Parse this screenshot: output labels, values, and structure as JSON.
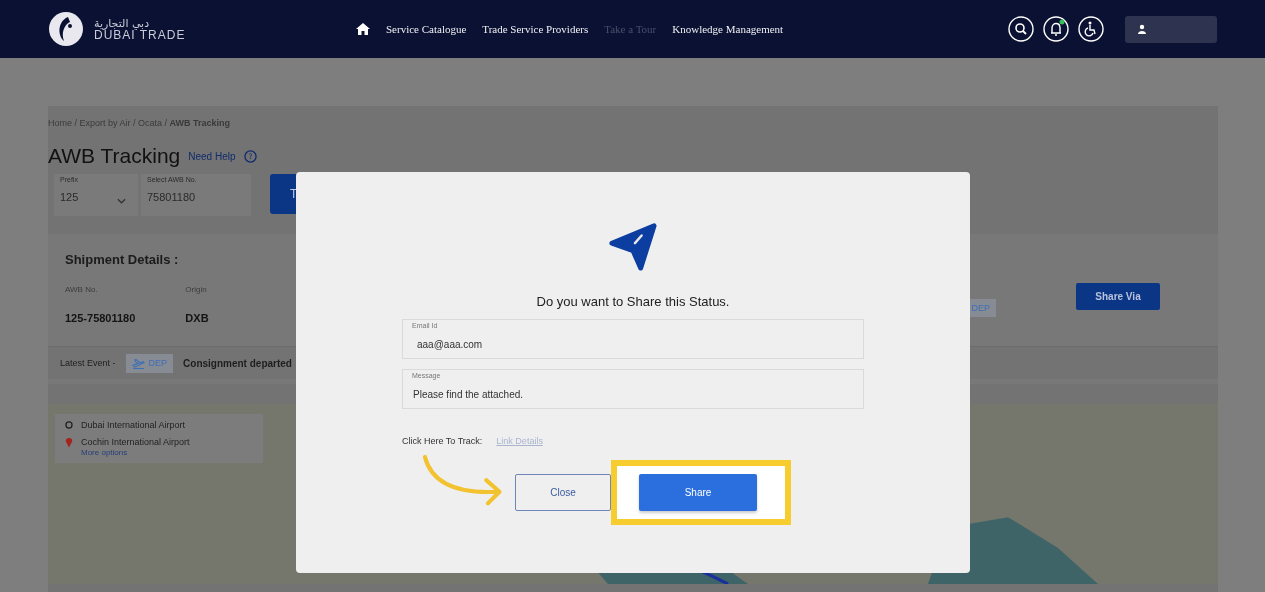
{
  "header": {
    "logo_arabic": "دبي التجارية",
    "logo_text": "DUBAI TRADE",
    "nav": [
      {
        "label": "Service Catalogue",
        "disabled": false
      },
      {
        "label": "Trade Service Providers",
        "disabled": false
      },
      {
        "label": "Take a Tour",
        "disabled": true
      },
      {
        "label": "Knowledge Management",
        "disabled": false
      }
    ]
  },
  "page": {
    "breadcrumb": "Home / Export by Air / Ocata / **AWB Tracking**",
    "title": "AWB Tracking",
    "help_link": "Need Help",
    "help_icon": "?",
    "prefix": {
      "label": "Prefix",
      "value": "125"
    },
    "awb": {
      "label": "Select AWB No.",
      "value": "75801180"
    },
    "track_button": "T",
    "shipment": {
      "heading": "Shipment Details :",
      "fields": [
        {
          "label": "AWB No.",
          "value": "125-75801180"
        },
        {
          "label": "Origin",
          "value": "DXB"
        }
      ],
      "status_badge": "DEP",
      "share_button": "Share Via",
      "latest_event": {
        "label": "Latest Event -",
        "badge": "DEP",
        "description": "Consignment departed"
      }
    },
    "map": {
      "route": [
        {
          "kind": "origin",
          "name": "Dubai International Airport"
        },
        {
          "kind": "destination",
          "name": "Cochin International Airport"
        }
      ],
      "more_options": "More options"
    }
  },
  "dialog": {
    "title": "Do you want to Share this Status.",
    "email": {
      "label": "Email Id",
      "value": "aaa@aaa.com"
    },
    "message": {
      "label": "Message",
      "value": "Please find the attached."
    },
    "track_label": "Click Here To Track:",
    "track_link": "Link Details",
    "buttons": [
      {
        "label": "Close",
        "kind": "secondary",
        "highlighted": false
      },
      {
        "label": "Share",
        "kind": "primary",
        "highlighted": true
      }
    ]
  }
}
